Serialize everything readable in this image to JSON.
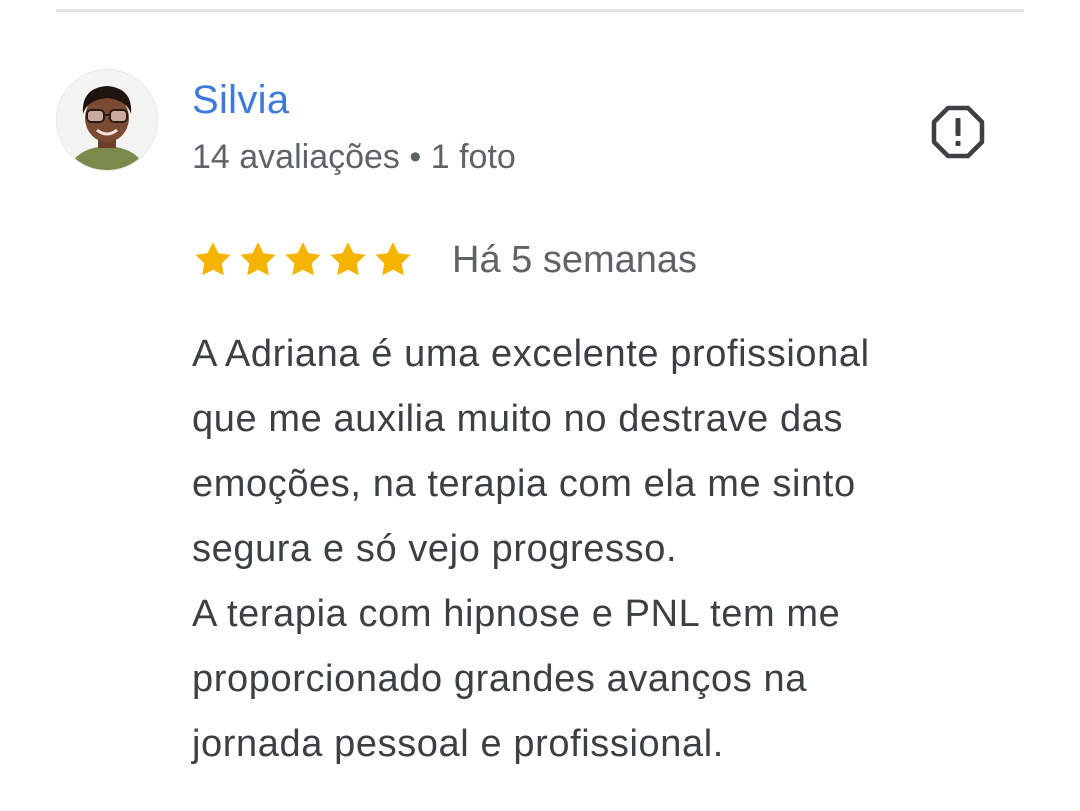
{
  "review": {
    "author": {
      "name": "Silvia",
      "reviews_count": "14 avaliações",
      "separator": "•",
      "photos_count": "1 foto",
      "avatar_icon": "user-photo-avatar"
    },
    "report_icon": "report-flag-icon",
    "rating": {
      "stars": 5,
      "max": 5,
      "star_color": "#f4b400"
    },
    "date": "Há 5 semanas",
    "text_lines": [
      "A Adriana é uma excelente profissional",
      "que me auxilia muito no destrave das",
      "emoções, na terapia com ela me sinto",
      "segura e só vejo progresso.",
      "A terapia com hipnose e PNL tem me",
      "proporcionado grandes avanços na",
      "jornada pessoal e profissional."
    ]
  },
  "colors": {
    "name": "#3d7bd9",
    "meta": "#5f6368",
    "body_text": "#3c4043",
    "divider": "#e1e3e6"
  }
}
